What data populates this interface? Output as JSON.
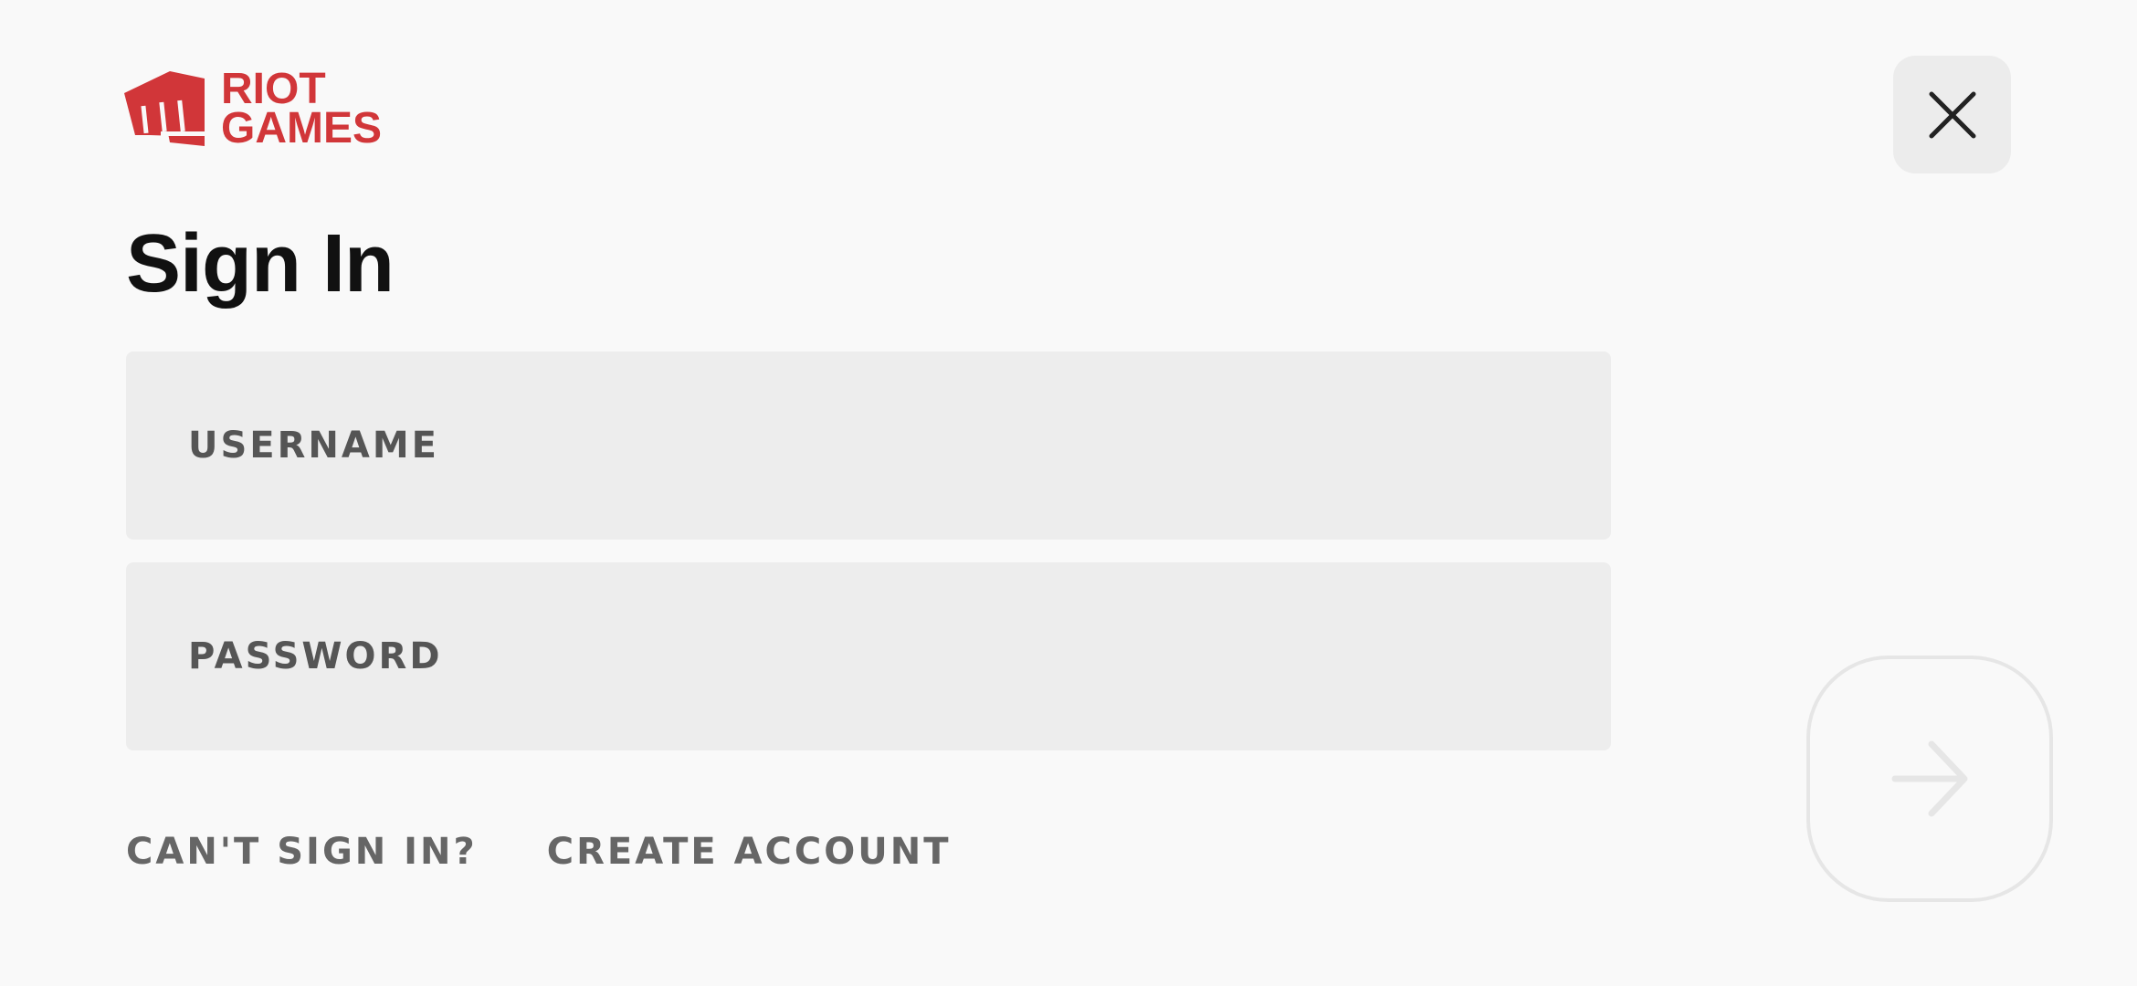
{
  "brand": {
    "line1": "RIOT",
    "line2": "GAMES",
    "color": "#d13639"
  },
  "header": {
    "title": "Sign In"
  },
  "form": {
    "username": {
      "value": "",
      "placeholder": "USERNAME"
    },
    "password": {
      "value": "",
      "placeholder": "PASSWORD"
    }
  },
  "links": {
    "cant_sign_in": "CAN'T SIGN IN?",
    "create_account": "CREATE ACCOUNT"
  },
  "icons": {
    "close": "close-icon",
    "submit": "arrow-right-icon",
    "logo": "riot-fist-icon"
  },
  "colors": {
    "background": "#f9f9f9",
    "field_bg": "#ededed",
    "submit_disabled": "#e6e6e6"
  }
}
